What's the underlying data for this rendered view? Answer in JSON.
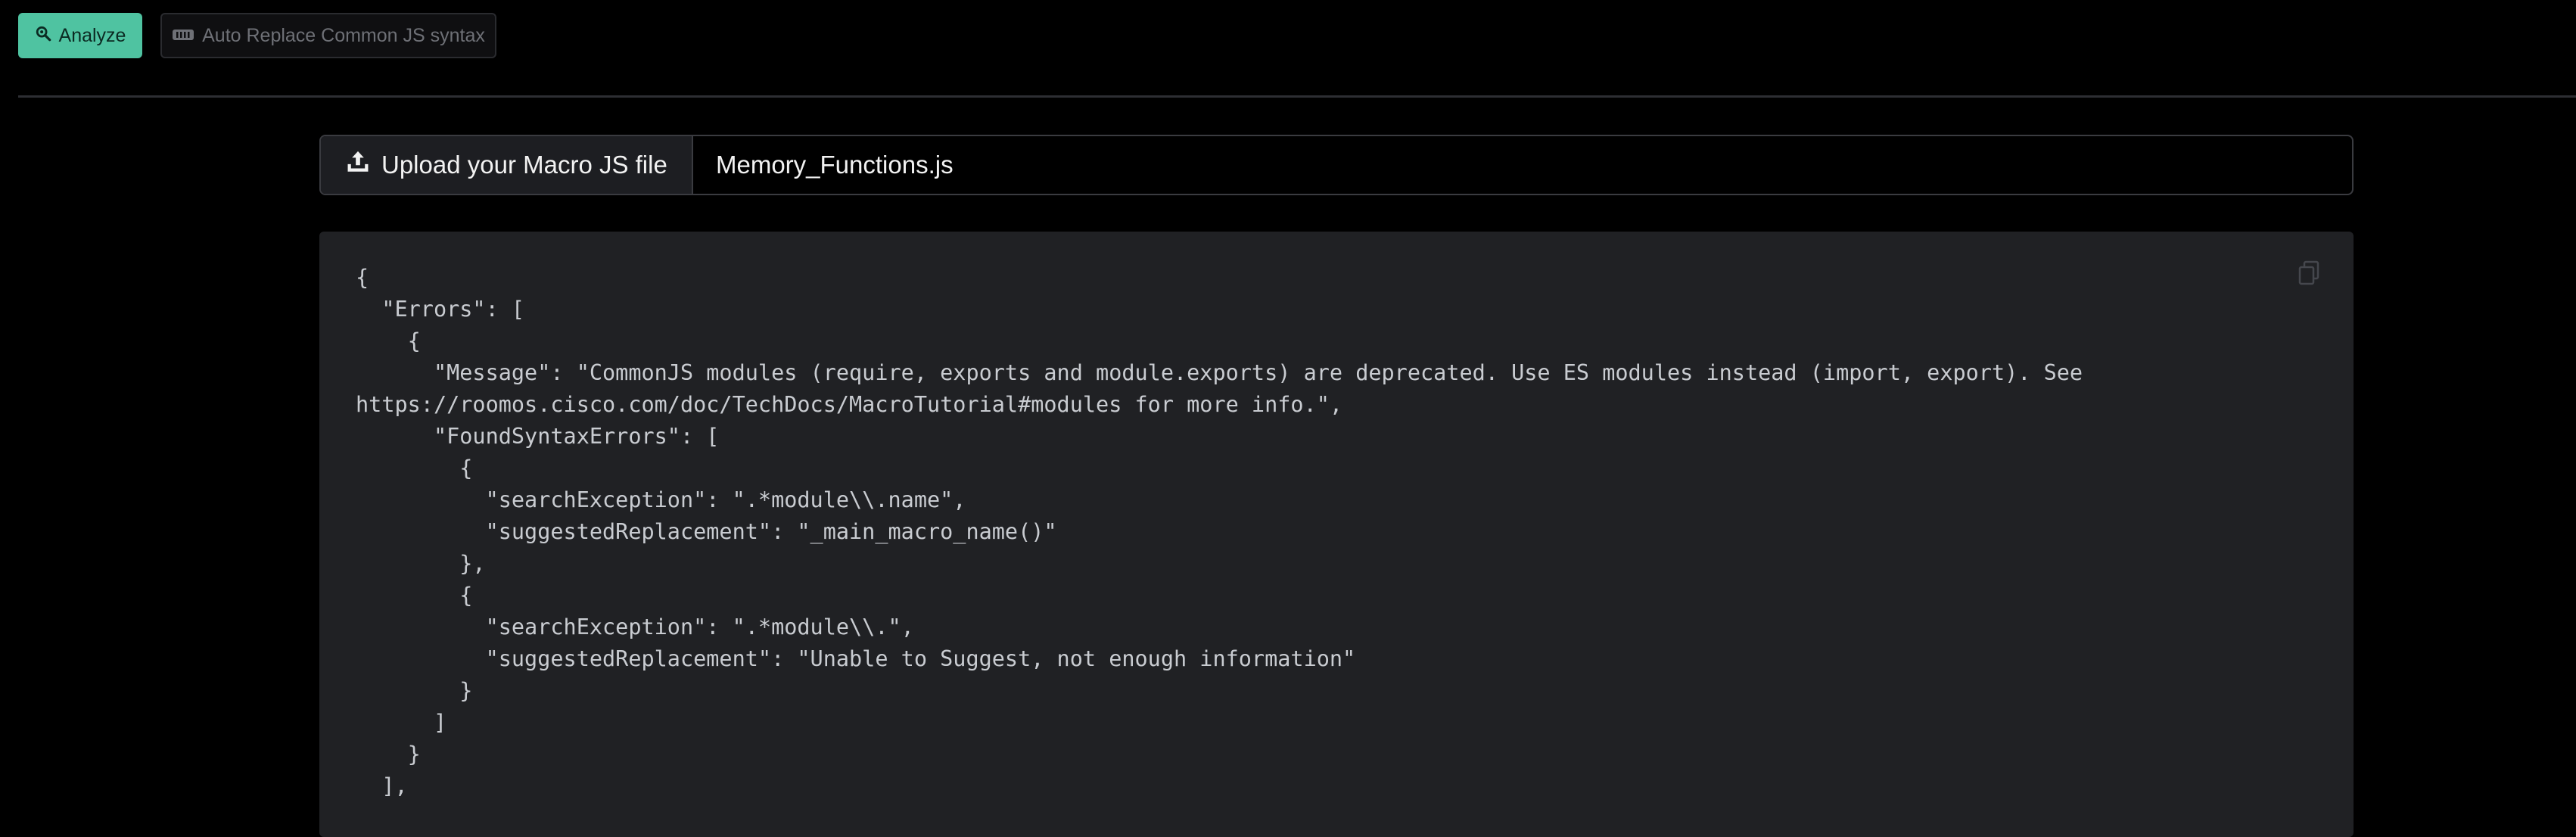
{
  "toolbar": {
    "analyze_label": "Analyze",
    "analyze_icon": "search-icon",
    "replace_label": "Auto Replace Common JS syntax",
    "replace_icon": "replace-icon"
  },
  "upload": {
    "button_label": "Upload your Macro JS file",
    "button_icon": "upload-icon",
    "file_name": "Memory_Functions.js"
  },
  "output": {
    "copy_icon": "copy-icon",
    "code": "{\n  \"Errors\": [\n    {\n      \"Message\": \"CommonJS modules (require, exports and module.exports) are deprecated. Use ES modules instead (import, export). See\nhttps://roomos.cisco.com/doc/TechDocs/MacroTutorial#modules for more info.\",\n      \"FoundSyntaxErrors\": [\n        {\n          \"searchException\": \".*module\\\\.name\",\n          \"suggestedReplacement\": \"_main_macro_name()\"\n        },\n        {\n          \"searchException\": \".*module\\\\.\",\n          \"suggestedReplacement\": \"Unable to Suggest, not enough information\"\n        }\n      ]\n    }\n  ],"
  },
  "colors": {
    "accent": "#4fc3a1",
    "background": "#000000",
    "panel": "#202124"
  }
}
